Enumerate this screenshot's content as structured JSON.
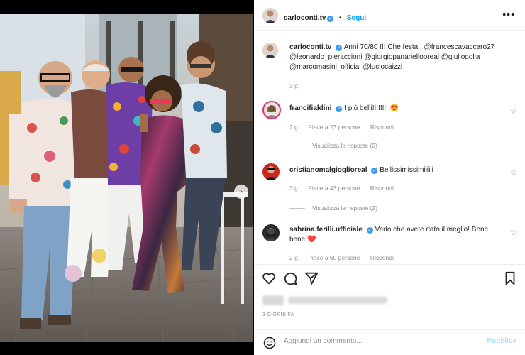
{
  "post": {
    "username": "carloconti.tv",
    "follow_label": "Segui",
    "more_label": "•••"
  },
  "caption": {
    "username": "carloconti.tv",
    "text": "Anni 70/80 !!! Che festa ! @francescavaccaro27 @leonardo_pieraccioni @giorgiopanariellooreal @giuliogolia @marcomasini_official @luciocaizzi",
    "time": "3 g"
  },
  "comments": [
    {
      "username": "francifialdini",
      "verified": true,
      "text": "I più belli!!!!!!!! 😍",
      "time": "2 g",
      "likes": "Piace a 23 persone",
      "reply": "Rispondi",
      "view_replies": "Visualizza le risposte (2)"
    },
    {
      "username": "cristianomalgioglioreal",
      "verified": true,
      "text": "Bellissimissimiiiiii",
      "time": "3 g",
      "likes": "Piace a 43 persone",
      "reply": "Rispondi",
      "view_replies": "Visualizza le risposte (2)"
    },
    {
      "username": "sabrina.ferilli.ufficiale",
      "verified": true,
      "text": "Vedo che avete dato il meglio! Bene bene!❤️",
      "time": "2 g",
      "likes": "Piace a 60 persone",
      "reply": "Rispondi"
    }
  ],
  "footer": {
    "days_ago": "3 GIORNI FA",
    "add_comment_placeholder": "Aggiungi un commento...",
    "publish_label": "Pubblica"
  },
  "icons": [
    "heart-icon",
    "comment-icon",
    "share-icon",
    "bookmark-icon",
    "emoji-icon",
    "chevron-right-icon"
  ],
  "carousel": {
    "pages": 4,
    "current": 1
  }
}
